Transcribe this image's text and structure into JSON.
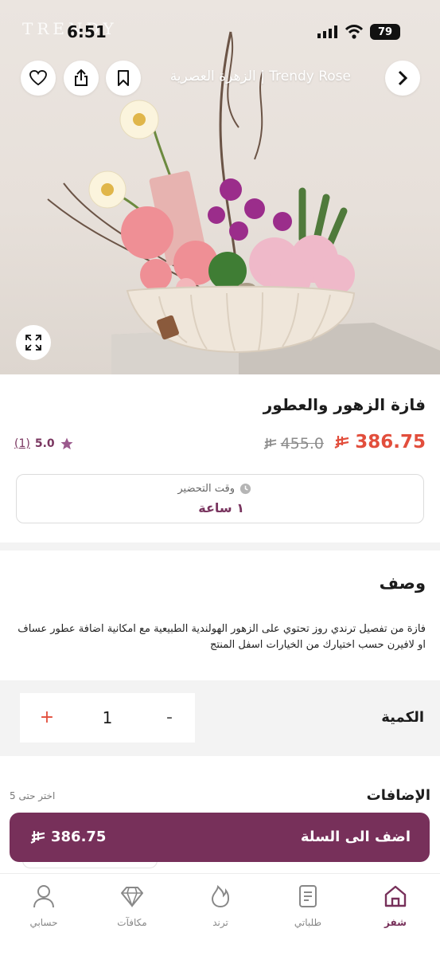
{
  "status_bar": {
    "time": "6:51",
    "battery": "79",
    "brand_watermark": "TRENDY"
  },
  "header": {
    "store_name": "Trendy Rose | الزهرة العصرية"
  },
  "product": {
    "name": "فازة الزهور والعطور",
    "price": "386.75",
    "old_price": "455.0",
    "rating": "5.0",
    "rating_count": "(1)",
    "prep_label": "وقت التحضير",
    "prep_value": "١ ساعة"
  },
  "description": {
    "title": "وصف",
    "text": "فازة من تفصيل ترندي روز تحتوي على الزهور الهولندية الطبيعية مع امكانية اضافة عطور عساف او لافيرن حسب اختيارك من الخيارات اسفل المنتج"
  },
  "quantity": {
    "label": "الكمية",
    "value": "1",
    "plus": "+",
    "minus": "-"
  },
  "addons": {
    "title": "الإضافات",
    "hint": "اختر حتى 5"
  },
  "cart": {
    "label": "اضف الى السلة",
    "price": "386.75"
  },
  "tabs": [
    {
      "label": "شفز",
      "icon": "home-icon",
      "active": true
    },
    {
      "label": "طلباتي",
      "icon": "orders-icon",
      "active": false
    },
    {
      "label": "ترند",
      "icon": "flame-icon",
      "active": false
    },
    {
      "label": "مكافآت",
      "icon": "diamond-icon",
      "active": false
    },
    {
      "label": "حسابي",
      "icon": "user-icon",
      "active": false
    }
  ],
  "colors": {
    "brand": "#77305a",
    "price": "#e24e3c",
    "rating_star": "#9b5a8d"
  }
}
